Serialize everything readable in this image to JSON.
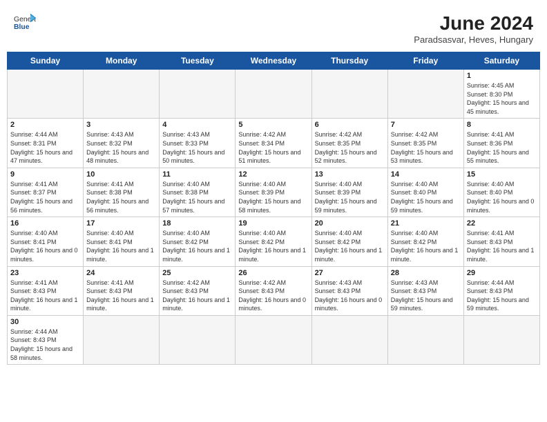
{
  "header": {
    "logo_general": "General",
    "logo_blue": "Blue",
    "title": "June 2024",
    "location": "Paradsasvar, Heves, Hungary"
  },
  "days_of_week": [
    "Sunday",
    "Monday",
    "Tuesday",
    "Wednesday",
    "Thursday",
    "Friday",
    "Saturday"
  ],
  "weeks": [
    [
      {
        "day": "",
        "info": ""
      },
      {
        "day": "",
        "info": ""
      },
      {
        "day": "",
        "info": ""
      },
      {
        "day": "",
        "info": ""
      },
      {
        "day": "",
        "info": ""
      },
      {
        "day": "",
        "info": ""
      },
      {
        "day": "1",
        "info": "Sunrise: 4:45 AM\nSunset: 8:30 PM\nDaylight: 15 hours and 45 minutes."
      }
    ],
    [
      {
        "day": "2",
        "info": "Sunrise: 4:44 AM\nSunset: 8:31 PM\nDaylight: 15 hours and 47 minutes."
      },
      {
        "day": "3",
        "info": "Sunrise: 4:43 AM\nSunset: 8:32 PM\nDaylight: 15 hours and 48 minutes."
      },
      {
        "day": "4",
        "info": "Sunrise: 4:43 AM\nSunset: 8:33 PM\nDaylight: 15 hours and 50 minutes."
      },
      {
        "day": "5",
        "info": "Sunrise: 4:42 AM\nSunset: 8:34 PM\nDaylight: 15 hours and 51 minutes."
      },
      {
        "day": "6",
        "info": "Sunrise: 4:42 AM\nSunset: 8:35 PM\nDaylight: 15 hours and 52 minutes."
      },
      {
        "day": "7",
        "info": "Sunrise: 4:42 AM\nSunset: 8:35 PM\nDaylight: 15 hours and 53 minutes."
      },
      {
        "day": "8",
        "info": "Sunrise: 4:41 AM\nSunset: 8:36 PM\nDaylight: 15 hours and 55 minutes."
      }
    ],
    [
      {
        "day": "9",
        "info": "Sunrise: 4:41 AM\nSunset: 8:37 PM\nDaylight: 15 hours and 56 minutes."
      },
      {
        "day": "10",
        "info": "Sunrise: 4:41 AM\nSunset: 8:38 PM\nDaylight: 15 hours and 56 minutes."
      },
      {
        "day": "11",
        "info": "Sunrise: 4:40 AM\nSunset: 8:38 PM\nDaylight: 15 hours and 57 minutes."
      },
      {
        "day": "12",
        "info": "Sunrise: 4:40 AM\nSunset: 8:39 PM\nDaylight: 15 hours and 58 minutes."
      },
      {
        "day": "13",
        "info": "Sunrise: 4:40 AM\nSunset: 8:39 PM\nDaylight: 15 hours and 59 minutes."
      },
      {
        "day": "14",
        "info": "Sunrise: 4:40 AM\nSunset: 8:40 PM\nDaylight: 15 hours and 59 minutes."
      },
      {
        "day": "15",
        "info": "Sunrise: 4:40 AM\nSunset: 8:40 PM\nDaylight: 16 hours and 0 minutes."
      }
    ],
    [
      {
        "day": "16",
        "info": "Sunrise: 4:40 AM\nSunset: 8:41 PM\nDaylight: 16 hours and 0 minutes."
      },
      {
        "day": "17",
        "info": "Sunrise: 4:40 AM\nSunset: 8:41 PM\nDaylight: 16 hours and 1 minute."
      },
      {
        "day": "18",
        "info": "Sunrise: 4:40 AM\nSunset: 8:42 PM\nDaylight: 16 hours and 1 minute."
      },
      {
        "day": "19",
        "info": "Sunrise: 4:40 AM\nSunset: 8:42 PM\nDaylight: 16 hours and 1 minute."
      },
      {
        "day": "20",
        "info": "Sunrise: 4:40 AM\nSunset: 8:42 PM\nDaylight: 16 hours and 1 minute."
      },
      {
        "day": "21",
        "info": "Sunrise: 4:40 AM\nSunset: 8:42 PM\nDaylight: 16 hours and 1 minute."
      },
      {
        "day": "22",
        "info": "Sunrise: 4:41 AM\nSunset: 8:43 PM\nDaylight: 16 hours and 1 minute."
      }
    ],
    [
      {
        "day": "23",
        "info": "Sunrise: 4:41 AM\nSunset: 8:43 PM\nDaylight: 16 hours and 1 minute."
      },
      {
        "day": "24",
        "info": "Sunrise: 4:41 AM\nSunset: 8:43 PM\nDaylight: 16 hours and 1 minute."
      },
      {
        "day": "25",
        "info": "Sunrise: 4:42 AM\nSunset: 8:43 PM\nDaylight: 16 hours and 1 minute."
      },
      {
        "day": "26",
        "info": "Sunrise: 4:42 AM\nSunset: 8:43 PM\nDaylight: 16 hours and 0 minutes."
      },
      {
        "day": "27",
        "info": "Sunrise: 4:43 AM\nSunset: 8:43 PM\nDaylight: 16 hours and 0 minutes."
      },
      {
        "day": "28",
        "info": "Sunrise: 4:43 AM\nSunset: 8:43 PM\nDaylight: 15 hours and 59 minutes."
      },
      {
        "day": "29",
        "info": "Sunrise: 4:44 AM\nSunset: 8:43 PM\nDaylight: 15 hours and 59 minutes."
      }
    ],
    [
      {
        "day": "30",
        "info": "Sunrise: 4:44 AM\nSunset: 8:43 PM\nDaylight: 15 hours and 58 minutes."
      },
      {
        "day": "",
        "info": ""
      },
      {
        "day": "",
        "info": ""
      },
      {
        "day": "",
        "info": ""
      },
      {
        "day": "",
        "info": ""
      },
      {
        "day": "",
        "info": ""
      },
      {
        "day": "",
        "info": ""
      }
    ]
  ]
}
